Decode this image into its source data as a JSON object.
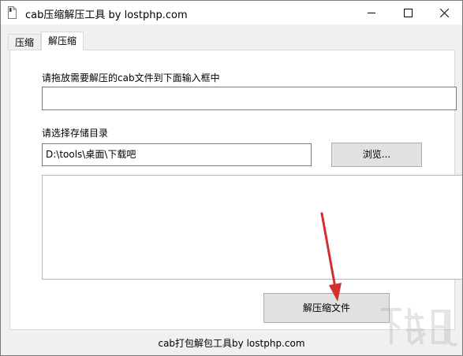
{
  "window": {
    "title": "cab压缩解压工具 by lostphp.com"
  },
  "tabs": [
    {
      "label": "压缩",
      "active": false
    },
    {
      "label": "解压缩",
      "active": true
    }
  ],
  "extract_panel": {
    "drag_label": "请拖放需要解压的cab文件到下面输入框中",
    "cab_path_value": "",
    "dir_label": "请选择存储目录",
    "dir_value": "D:\\tools\\桌面\\下载吧",
    "browse_label": "浏览...",
    "log_value": "",
    "extract_button_label": "解压缩文件"
  },
  "footer": "cab打包解包工具by lostphp.com",
  "colors": {
    "annotation_arrow": "#d32f2f",
    "window_background": "#f0f0f0",
    "button_face": "#e1e1e1"
  },
  "icons": [
    "app-icon",
    "minimize-icon",
    "maximize-icon",
    "close-icon"
  ],
  "watermark_text": "下载吧"
}
